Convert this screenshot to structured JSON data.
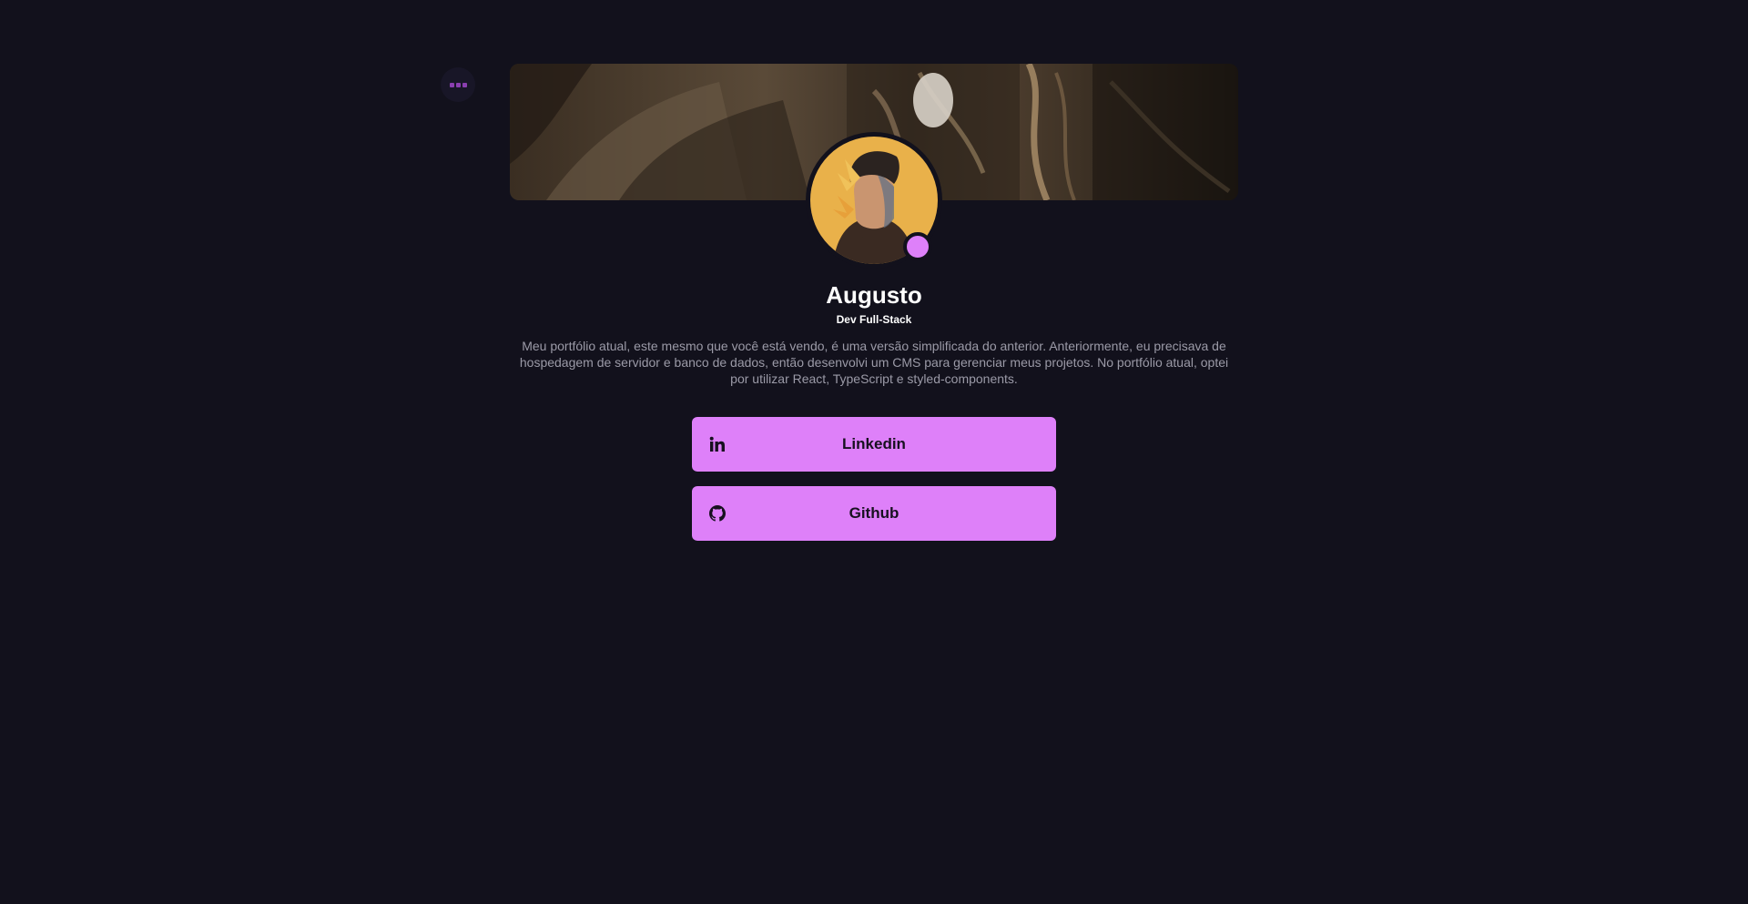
{
  "colors": {
    "background": "#12111c",
    "accent": "#de80f9",
    "accent_dark": "#8a3fb0",
    "button_text": "#17101f",
    "muted_text": "#9b9aa7"
  },
  "menu": {
    "icon": "menu-dots-icon"
  },
  "profile": {
    "name": "Augusto",
    "role": "Dev Full-Stack",
    "bio": "Meu portfólio atual, este mesmo que você está vendo, é uma versão simplificada do anterior. Anteriormente, eu precisava de hospedagem de servidor e banco de dados, então desenvolvi um CMS para gerenciar meus projetos. No portfólio atual, optei por utilizar React, TypeScript e styled-components."
  },
  "links": [
    {
      "label": "Linkedin",
      "icon": "linkedin-icon"
    },
    {
      "label": "Github",
      "icon": "github-icon"
    }
  ]
}
